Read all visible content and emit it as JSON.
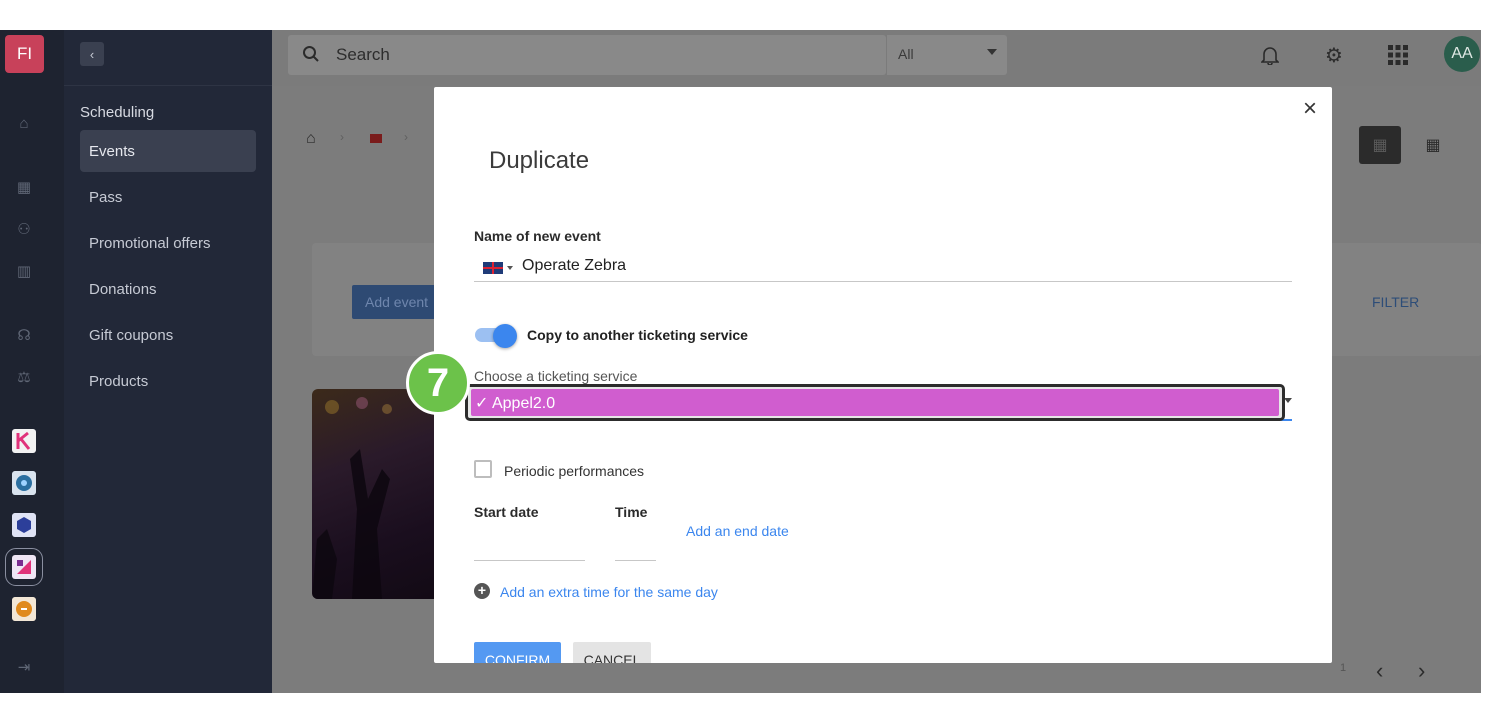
{
  "app": {
    "logo_text": "FI"
  },
  "search": {
    "placeholder": "Search",
    "scope": "All"
  },
  "user": {
    "initials": "AA"
  },
  "sidebar": {
    "heading": "Scheduling",
    "items": [
      {
        "label": "Events",
        "active": true
      },
      {
        "label": "Pass",
        "active": false
      },
      {
        "label": "Promotional offers",
        "active": false
      },
      {
        "label": "Donations",
        "active": false
      },
      {
        "label": "Gift coupons",
        "active": false
      },
      {
        "label": "Products",
        "active": false
      }
    ]
  },
  "rail": {
    "icons": [
      "home-icon",
      "calculator-icon",
      "users-icon",
      "building-icon",
      "headset-icon",
      "scale-icon",
      "logout-icon"
    ],
    "apps": [
      {
        "name": "app-k-icon",
        "color": "#3b6fd6"
      },
      {
        "name": "app-disc-icon",
        "color": "#2b6fa0"
      },
      {
        "name": "app-cube-icon",
        "color": "#2c3f9a"
      },
      {
        "name": "app-ticket-icon",
        "color": "#7b2d91"
      },
      {
        "name": "app-orange-icon",
        "color": "#e08a1e"
      }
    ]
  },
  "background": {
    "add_event_label": "Add event",
    "filter_label": "FILTER",
    "page_number": "1"
  },
  "modal": {
    "title": "Duplicate",
    "name_label": "Name of new event",
    "name_value": "Operate Zebra",
    "copy_toggle_label": "Copy to another ticketing service",
    "copy_toggle_on": true,
    "choose_label": "Choose a ticketing service",
    "selected_option": "✓ Appel2.0",
    "periodic_label": "Periodic performances",
    "periodic_checked": false,
    "start_date_label": "Start date",
    "time_label": "Time",
    "add_end_date_label": "Add an end date",
    "add_extra_time_label": "Add an extra time for the same day",
    "confirm_label": "CONFIRM",
    "cancel_label": "CANCEL"
  },
  "step_badge": "7",
  "colors": {
    "accent": "#3b86ee",
    "badge": "#6cc24a",
    "highlight": "#d05dcf"
  }
}
